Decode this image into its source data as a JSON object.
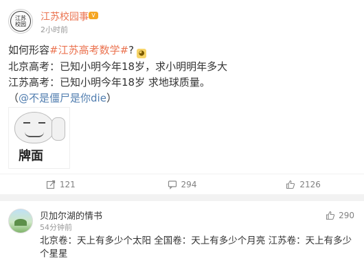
{
  "post": {
    "author": "江苏校园事",
    "avatar_text": [
      "江",
      "苏",
      "校",
      "园"
    ],
    "vip_badge": "V",
    "time": "2小时前",
    "line1_prefix": "如何形容",
    "line1_hashtag": "#江苏高考数学#",
    "line1_suffix": "?",
    "line2": "北京高考：已知小明今年18岁，求小明明年多大",
    "line3": "江苏高考：已知小明今年18岁 求地球质量。",
    "line4_open": "（",
    "line4_mention": "@不是僵尸是你die",
    "line4_close": "）",
    "meme_caption": "牌面"
  },
  "actions": {
    "repost_count": "121",
    "comment_count": "294",
    "like_count": "2126"
  },
  "comment": {
    "author": "贝加尔湖的情书",
    "time": "54分钟前",
    "like_count": "290",
    "text": "北京卷：天上有多少个太阳 全国卷：天上有多少个月亮 江苏卷：天上有多少个星星"
  },
  "colors": {
    "accent_orange": "#eb7350",
    "mention_blue": "#507daf",
    "muted": "#808080"
  }
}
